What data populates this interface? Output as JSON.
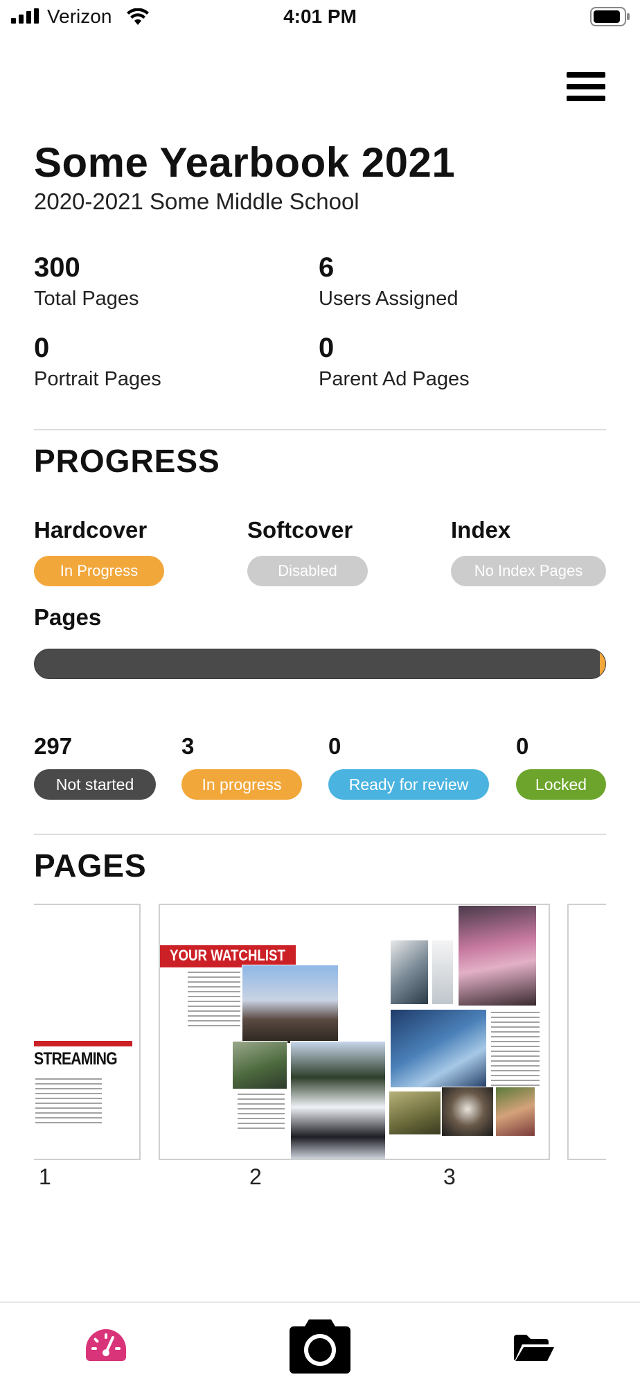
{
  "status_bar": {
    "carrier": "Verizon",
    "time": "4:01 PM"
  },
  "yearbook": {
    "title": "Some Yearbook 2021",
    "subtitle": "2020-2021 Some Middle School"
  },
  "stats": {
    "total_pages": {
      "value": "300",
      "label": "Total Pages"
    },
    "users_assigned": {
      "value": "6",
      "label": "Users Assigned"
    },
    "portrait_pages": {
      "value": "0",
      "label": "Portrait Pages"
    },
    "parent_ad_pages": {
      "value": "0",
      "label": "Parent Ad Pages"
    }
  },
  "progress": {
    "heading": "PROGRESS",
    "hardcover": {
      "label": "Hardcover",
      "status": "In Progress",
      "color": "#f2a73b"
    },
    "softcover": {
      "label": "Softcover",
      "status": "Disabled",
      "color": "#cccccc"
    },
    "index": {
      "label": "Index",
      "status": "No Index Pages",
      "color": "#cccccc"
    },
    "pages_label": "Pages",
    "pages_fraction_in_progress": 0.01,
    "counts": {
      "not_started": {
        "value": "297",
        "label": "Not started",
        "color": "#4a4a4a"
      },
      "in_progress": {
        "value": "3",
        "label": "In progress",
        "color": "#f2a73b"
      },
      "ready_for_review": {
        "value": "0",
        "label": "Ready for review",
        "color": "#4ab3e0"
      },
      "locked": {
        "value": "0",
        "label": "Locked",
        "color": "#6da52c"
      }
    }
  },
  "pages": {
    "heading": "PAGES",
    "thumbnails": [
      {
        "number": "1",
        "headline": "STREAMING"
      },
      {
        "number": "2",
        "headline": "YOUR WATCHLIST"
      },
      {
        "number": "3"
      }
    ]
  },
  "bottom_nav": {
    "items": [
      "dashboard-icon",
      "camera-icon",
      "folder-icon"
    ]
  }
}
